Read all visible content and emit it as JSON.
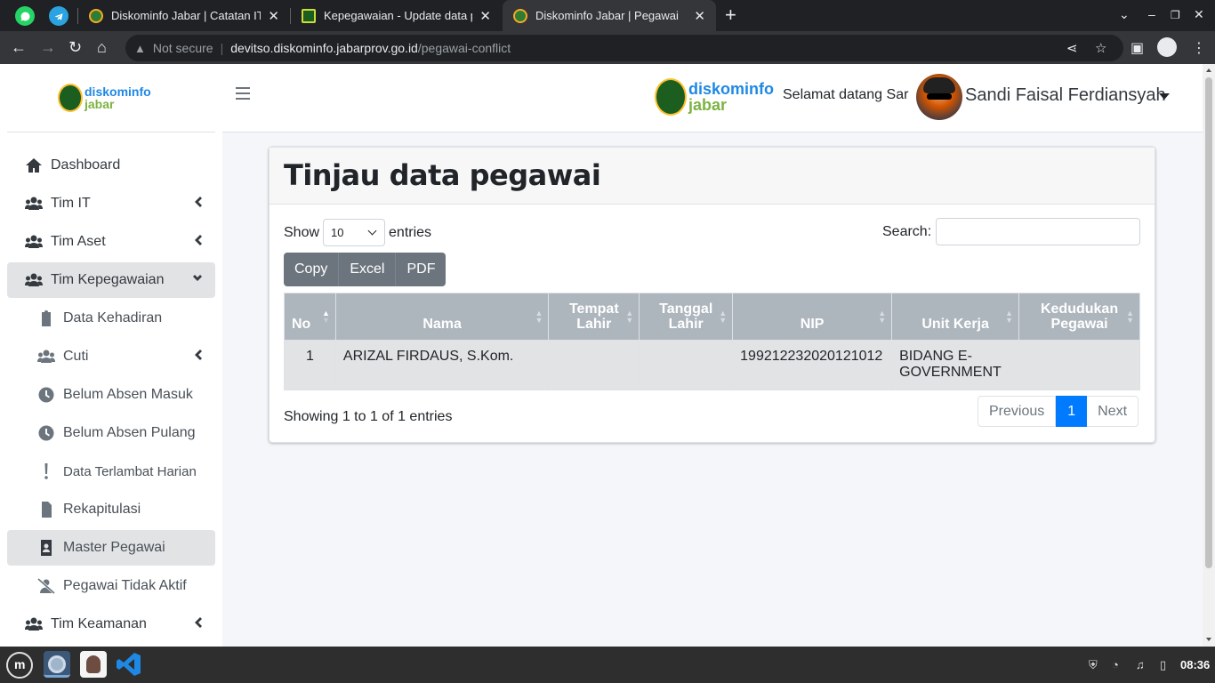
{
  "browser": {
    "tabs": [
      {
        "title": "Diskominfo Jabar | Catatan IT",
        "active": false
      },
      {
        "title": "Kepegawaian - Update data p",
        "active": false
      },
      {
        "title": "Diskominfo Jabar | Pegawai",
        "active": true
      }
    ],
    "new_tab": "+",
    "security": "Not secure",
    "url_host": "devitso.diskominfo.jabarprov.go.id",
    "url_path": "/pegawai-conflict"
  },
  "brand": {
    "logo_line1": "diskominfo",
    "logo_line2": "jabar"
  },
  "sidebar": {
    "items": [
      {
        "label": "Dashboard",
        "icon": "home-icon",
        "level": 0
      },
      {
        "label": "Tim IT",
        "icon": "users-icon",
        "level": 0,
        "expandable": true
      },
      {
        "label": "Tim Aset",
        "icon": "users-icon",
        "level": 0,
        "expandable": true
      },
      {
        "label": "Tim Kepegawaian",
        "icon": "users-icon",
        "level": 0,
        "expandable": true,
        "expanded": true
      },
      {
        "label": "Data Kehadiran",
        "icon": "clipboard-icon",
        "level": 1
      },
      {
        "label": "Cuti",
        "icon": "users-icon",
        "level": 1,
        "expandable": true
      },
      {
        "label": "Belum Absen Masuk",
        "icon": "clock-icon",
        "level": 1
      },
      {
        "label": "Belum Absen Pulang",
        "icon": "clock-icon",
        "level": 1
      },
      {
        "label": "Data Terlambat Harian",
        "icon": "exclamation-icon",
        "level": 1
      },
      {
        "label": "Rekapitulasi",
        "icon": "file-icon",
        "level": 1
      },
      {
        "label": "Master Pegawai",
        "icon": "id-card-icon",
        "level": 1,
        "active": true
      },
      {
        "label": "Pegawai Tidak Aktif",
        "icon": "user-slash-icon",
        "level": 1
      },
      {
        "label": "Tim Keamanan",
        "icon": "users-icon",
        "level": 0,
        "expandable": true
      }
    ]
  },
  "header": {
    "welcome": "Selamat datang Sar",
    "user_name": "Sandi Faisal Ferdiansyah"
  },
  "card": {
    "title": "Tinjau data pegawai",
    "show_label": "Show",
    "page_length": "10",
    "entries_label": "entries",
    "search_label": "Search:",
    "search_value": "",
    "buttons": [
      "Copy",
      "Excel",
      "PDF"
    ],
    "columns": [
      "No",
      "Nama",
      "Tempat Lahir",
      "Tanggal Lahir",
      "NIP",
      "Unit Kerja",
      "Kedudukan Pegawai"
    ],
    "rows": [
      [
        "1",
        "ARIZAL FIRDAUS, S.Kom.",
        "",
        "",
        "199212232020121012",
        "BIDANG E-GOVERNMENT",
        ""
      ]
    ],
    "info": "Showing 1 to 1 of 1 entries",
    "pagination": {
      "previous": "Previous",
      "current": "1",
      "next": "Next"
    }
  },
  "taskbar": {
    "clock": "08:36"
  },
  "colors": {
    "primary": "#007bff",
    "header_gray": "#adb5bd",
    "button_gray": "#6c757d"
  }
}
